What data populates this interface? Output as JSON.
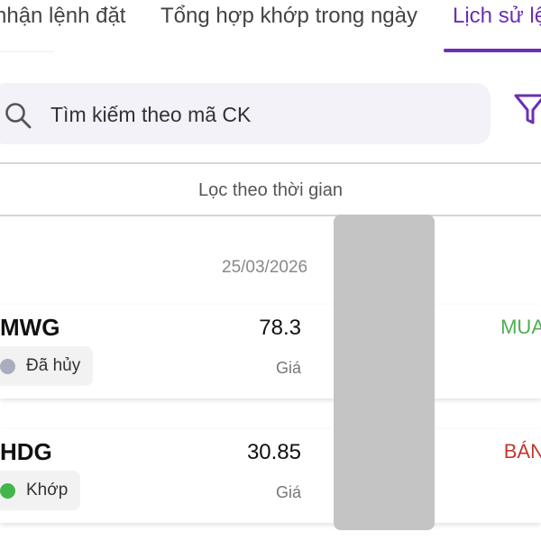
{
  "tabs": [
    {
      "label": "nhận lệnh đặt"
    },
    {
      "label": "Tổng hợp khớp trong ngày"
    },
    {
      "label": "Lịch sử lệ"
    }
  ],
  "search": {
    "placeholder": "Tìm kiếm theo mã CK"
  },
  "time_filter": {
    "label": "Lọc theo thời gian"
  },
  "date_header": "25/03/2026",
  "orders": [
    {
      "symbol": "MWG",
      "status": "Đã hủy",
      "status_color": "#a9adbd",
      "price": "78.3",
      "price_label": "Giá",
      "side": "MUA",
      "side_color": "#4caf50"
    },
    {
      "symbol": "HDG",
      "status": "Khớp",
      "status_color": "#43b649",
      "price": "30.85",
      "price_label": "Giá",
      "side": "BÁN",
      "side_color": "#c0392b"
    }
  ],
  "colors": {
    "accent": "#6b2fb3"
  }
}
